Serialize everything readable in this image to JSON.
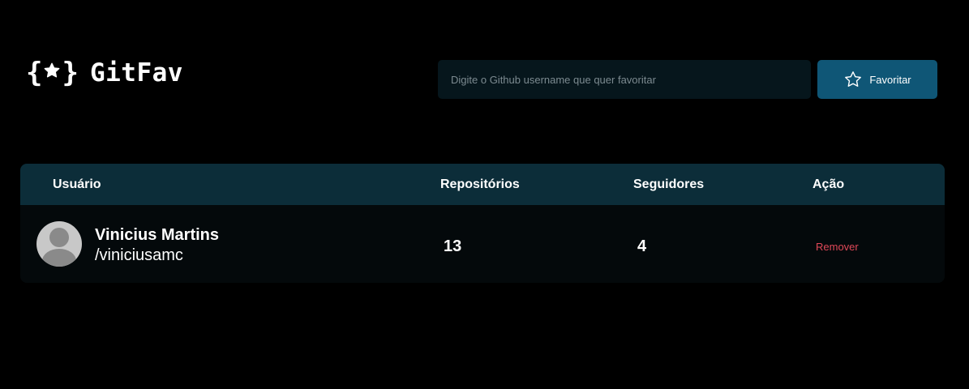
{
  "header": {
    "logo_text": "GitFav",
    "logo_brace_open": "{",
    "logo_brace_close": "}",
    "logo_star_icon": "star-filled-icon",
    "search_placeholder": "Digite o Github username que quer favoritar",
    "search_value": "",
    "favorite_button_label": "Favoritar",
    "favorite_button_icon": "star-outline-icon"
  },
  "table": {
    "columns": [
      "Usuário",
      "Repositórios",
      "Seguidores",
      "Ação"
    ],
    "rows": [
      {
        "name": "Vinicius Martins",
        "login": "/viniciusamc",
        "repositories": "13",
        "followers": "4",
        "action_label": "Remover",
        "avatar_icon": "avatar-placeholder-icon"
      }
    ]
  },
  "colors": {
    "background": "#000000",
    "header_row": "#0c2d39",
    "body_row": "#04090b",
    "input_bg": "#06161c",
    "button_bg": "#0f5676",
    "remove_text": "#e04858"
  }
}
